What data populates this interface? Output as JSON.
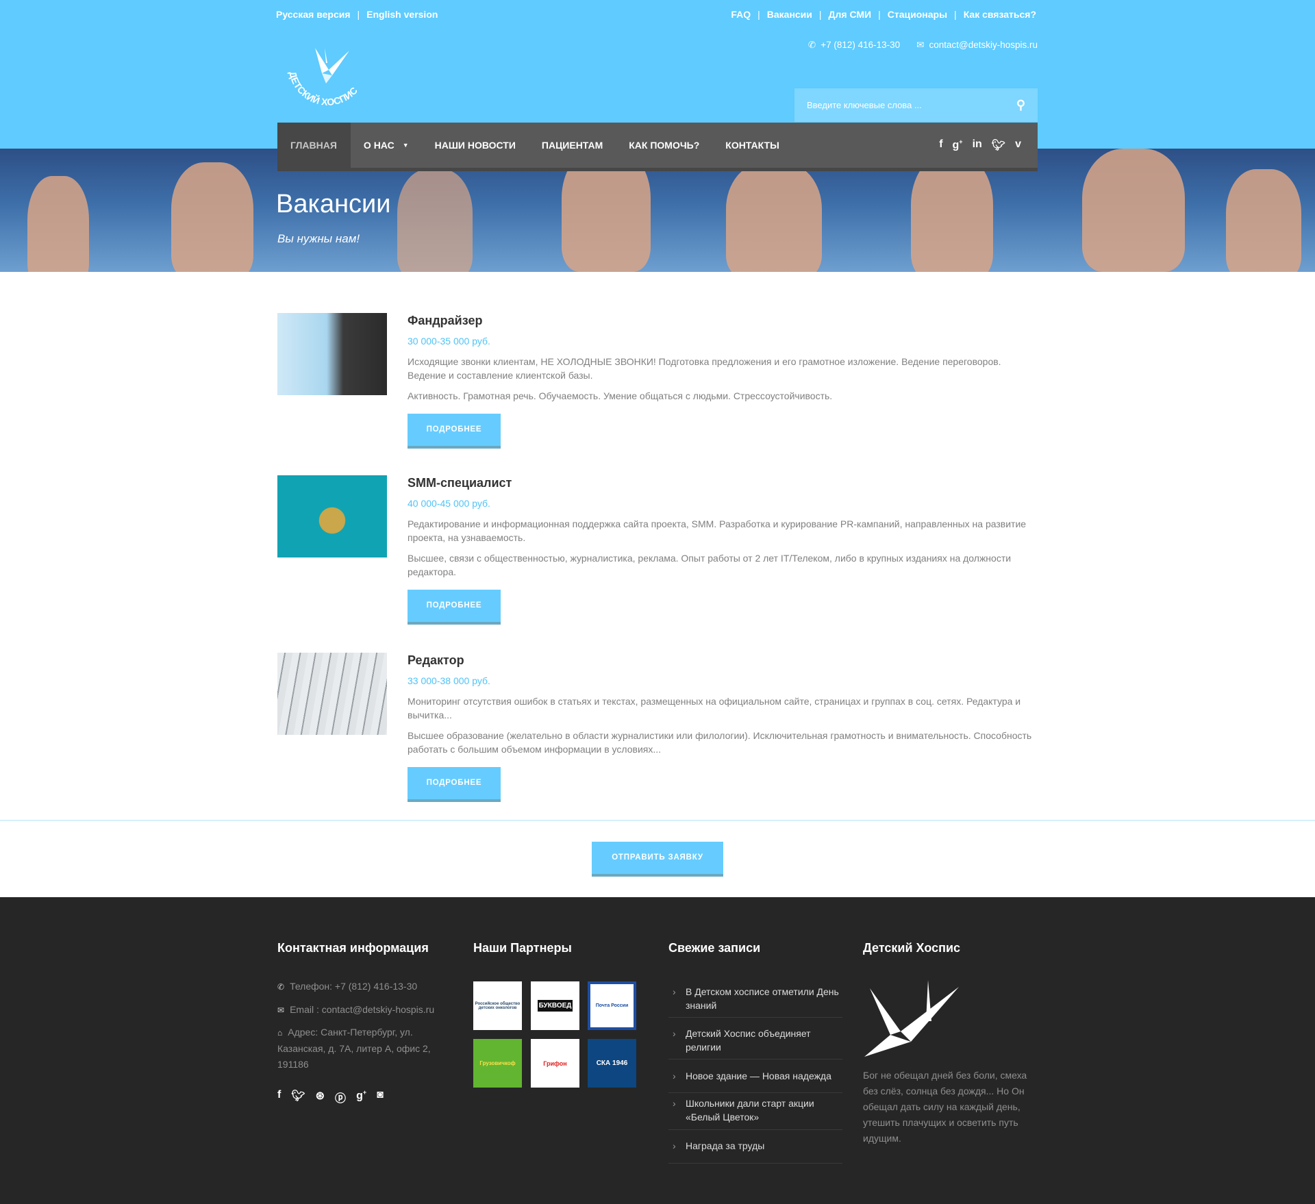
{
  "colors": {
    "brand": "#5fcbfe",
    "button": "#66ccff",
    "salary": "#4fc3f7",
    "nav": "#595959",
    "footer": "#262626"
  },
  "top": {
    "lang": [
      "Русская версия",
      "English version"
    ],
    "links": [
      "FAQ",
      "Вакансии",
      "Для СМИ",
      "Стационары",
      "Как связаться?"
    ],
    "phone": "+7 (812) 416-13-30",
    "email": "contact@detskiy-hospis.ru"
  },
  "logo": {
    "text": "ДЕТСКИЙ ХОСПИС"
  },
  "search": {
    "placeholder": "Введите ключевые слова ..."
  },
  "nav": {
    "items": [
      "ГЛАВНАЯ",
      "О НАС",
      "НАШИ НОВОСТИ",
      "ПАЦИЕНТАМ",
      "КАК ПОМОЧЬ?",
      "КОНТАКТЫ"
    ],
    "social": [
      "facebook-icon",
      "google-plus-icon",
      "linkedin-icon",
      "twitter-icon",
      "vimeo-icon"
    ]
  },
  "banner": {
    "title": "Вакансии",
    "subtitle": "Вы нужны нам!"
  },
  "vacancies": [
    {
      "title": "Фандрайзер",
      "salary": "30 000-35 000 руб.",
      "desc": "Исходящие звонки клиентам, НЕ ХОЛОДНЫЕ ЗВОНКИ! Подготовка предложения и его грамотное изложение. Ведение переговоров. Ведение и составление клиентской базы.",
      "req": "Активность. Грамотная речь. Обучаемость. Умение общаться с людьми. Стрессоустойчивость.",
      "button": "ПОДРОБНЕЕ"
    },
    {
      "title": "SMM-специалист",
      "salary": "40 000-45 000 руб.",
      "desc": "Редактирование и информационная поддержка сайта проекта, SMM. Разработка и курирование PR-кампаний, направленных на развитие проекта, на узнаваемость.",
      "req": "Высшее, связи с общественностью, журналистика, реклама. Опыт работы от 2 лет IT/Телеком, либо в крупных изданиях на должности редактора.",
      "button": "ПОДРОБНЕЕ"
    },
    {
      "title": "Редактор",
      "salary": "33 000-38 000 руб.",
      "desc": "Мониторинг отсутствия ошибок в статьях и текстах, размещенных на официальном сайте, страницах и группах в соц. сетях. Редактура и вычитка...",
      "req": "Высшее образование (желательно в области журналистики или филологии). Исключительная грамотность и внимательность. Способность работать с большим объемом информации в условиях...",
      "button": "ПОДРОБНЕЕ"
    }
  ],
  "submit": "ОТПРАВИТЬ ЗАЯВКУ",
  "footer": {
    "contact": {
      "title": "Контактная информация",
      "phone": "Телефон: +7 (812) 416-13-30",
      "email": "Email : contact@detskiy-hospis.ru",
      "address": "Адрес: Санкт-Петербург, ул. Казанская, д. 7А, литер А, офис 2, 191186",
      "social": [
        "facebook-icon",
        "twitter-icon",
        "dribbble-icon",
        "pinterest-icon",
        "google-plus-icon",
        "instagram-icon"
      ]
    },
    "partners": {
      "title": "Наши Партнеры",
      "logos": [
        "Российское общество детских онкологов",
        "БУКВОЕД",
        "Почта России",
        "Грузовичкоф",
        "Грифон",
        "СКА 1946"
      ]
    },
    "posts": {
      "title": "Свежие записи",
      "items": [
        "В Детском хосписе отметили День знаний",
        "Детский Хоспис объединяет религии",
        "Новое здание — Новая надежда",
        "Школьники дали старт акции «Белый Цветок»",
        "Награда за труды"
      ]
    },
    "about": {
      "title": "Детский Хоспис",
      "quote": "Бог не обещал дней без боли, смеха без слёз, солнца без дождя... Но Он обещал дать силу на каждый день, утешить плачущих и осветить путь идущим."
    }
  }
}
